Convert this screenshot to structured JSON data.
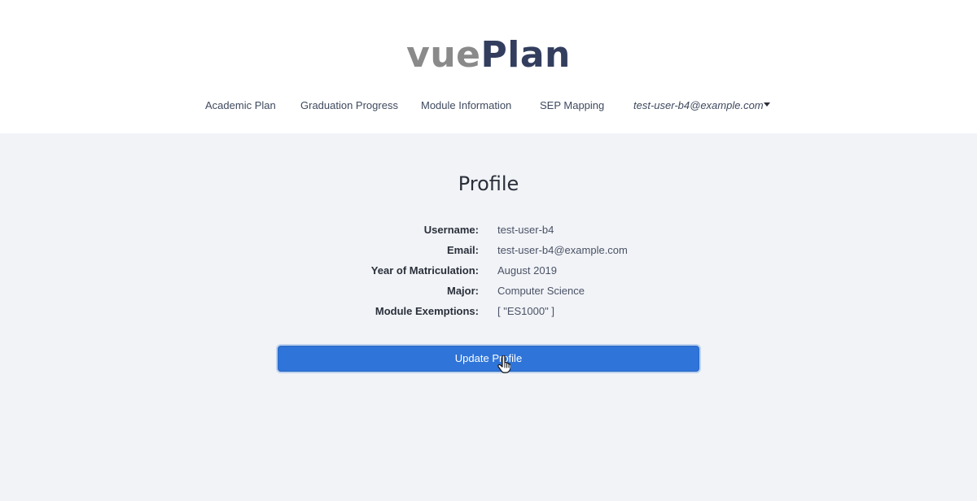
{
  "header": {
    "logo": {
      "part1": "vue",
      "part2": "Plan"
    },
    "nav": [
      {
        "label": "Academic Plan"
      },
      {
        "label": "Graduation Progress"
      },
      {
        "label": "Module Information"
      },
      {
        "label": "SEP Mapping"
      }
    ],
    "user_menu": {
      "label": "test-user-b4@example.com",
      "icon": "caret-down-icon"
    }
  },
  "main": {
    "title": "Profile",
    "fields": [
      {
        "label": "Username:",
        "value": "test-user-b4"
      },
      {
        "label": "Email:",
        "value": "test-user-b4@example.com"
      },
      {
        "label": "Year of Matriculation:",
        "value": "August 2019"
      },
      {
        "label": "Major:",
        "value": "Computer Science"
      },
      {
        "label": "Module Exemptions:",
        "value": "[ \"ES1000\" ]"
      }
    ],
    "update_button": {
      "label": "Update Profile"
    }
  },
  "colors": {
    "page_bg": "#f1f3f7",
    "header_bg": "#ffffff",
    "primary": "#2f74d8",
    "logo_gray": "#8a8a8a",
    "logo_navy": "#333e5e"
  }
}
